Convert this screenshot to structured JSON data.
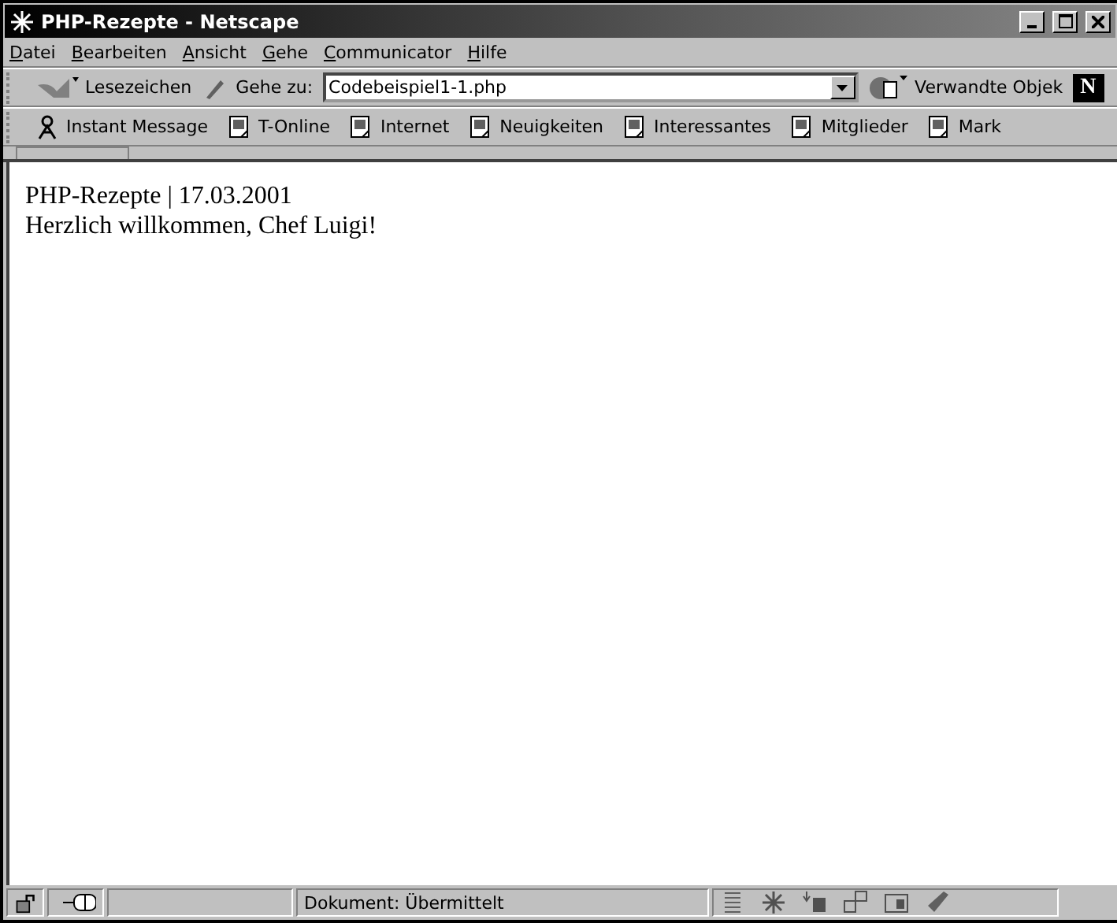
{
  "window": {
    "title": "PHP-Rezepte - Netscape"
  },
  "menu": [
    "Datei",
    "Bearbeiten",
    "Ansicht",
    "Gehe",
    "Communicator",
    "Hilfe"
  ],
  "navigation_toolbar": {
    "bookmarks": "Lesezeichen",
    "goto_label": "Gehe zu:",
    "location": "Codebeispiel1-1.php",
    "related": "Verwandte Objek",
    "logo": "N"
  },
  "personal_toolbar": [
    {
      "kind": "messenger",
      "label": "Instant Message"
    },
    {
      "kind": "page",
      "label": "T-Online"
    },
    {
      "kind": "page",
      "label": "Internet"
    },
    {
      "kind": "page",
      "label": "Neuigkeiten"
    },
    {
      "kind": "page",
      "label": "Interessantes"
    },
    {
      "kind": "page",
      "label": "Mitglieder"
    },
    {
      "kind": "page",
      "label": "Mark"
    }
  ],
  "content": {
    "lines": [
      "PHP-Rezepte | 17.03.2001",
      "Herzlich willkommen, Chef Luigi!"
    ]
  },
  "status_bar": {
    "text": "Dokument: Übermittelt"
  }
}
